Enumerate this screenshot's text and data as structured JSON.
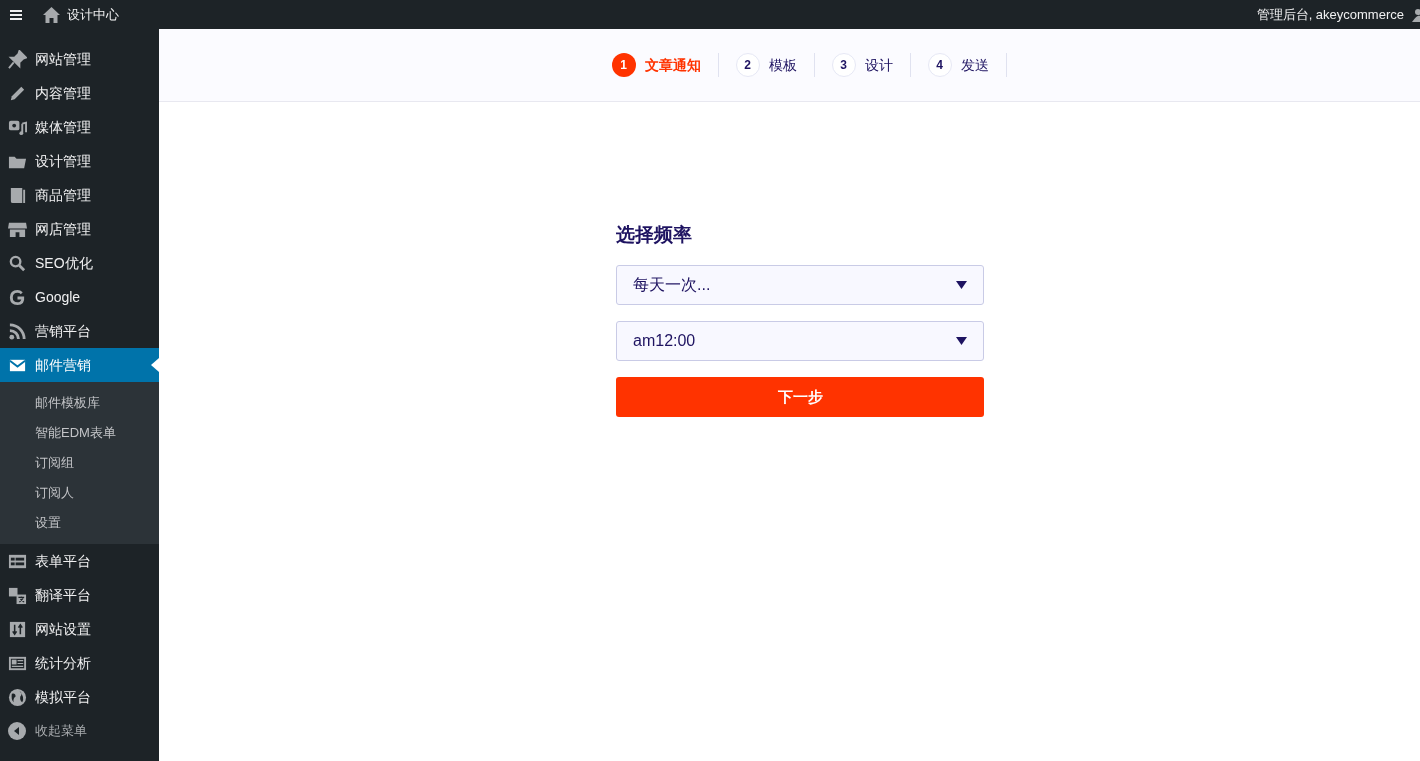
{
  "top_bar": {
    "site_title": "设计中心",
    "account": "管理后台, akeycommerce"
  },
  "sidebar": {
    "items": [
      {
        "label": "网站管理",
        "selected": false
      },
      {
        "label": "内容管理",
        "selected": false
      },
      {
        "label": "媒体管理",
        "selected": false
      },
      {
        "label": "设计管理",
        "selected": false
      },
      {
        "label": "商品管理",
        "selected": false
      },
      {
        "label": "网店管理",
        "selected": false
      },
      {
        "label": "SEO优化",
        "selected": false
      },
      {
        "label": "Google",
        "selected": false
      },
      {
        "label": "营销平台",
        "selected": false
      },
      {
        "label": "邮件营销",
        "selected": true,
        "children": [
          {
            "label": "邮件模板库"
          },
          {
            "label": "智能EDM表单"
          },
          {
            "label": "订阅组"
          },
          {
            "label": "订阅人"
          },
          {
            "label": "设置"
          }
        ]
      },
      {
        "label": "表单平台",
        "selected": false
      },
      {
        "label": "翻译平台",
        "selected": false
      },
      {
        "label": "网站设置",
        "selected": false
      },
      {
        "label": "统计分析",
        "selected": false
      },
      {
        "label": "模拟平台",
        "selected": false
      }
    ],
    "collapse": "收起菜单"
  },
  "steps": [
    {
      "number": "1",
      "label": "文章通知",
      "selected": true
    },
    {
      "number": "2",
      "label": "模板",
      "selected": false
    },
    {
      "number": "3",
      "label": "设计",
      "selected": false
    },
    {
      "number": "4",
      "label": "发送",
      "selected": false
    }
  ],
  "form": {
    "heading": "选择频率",
    "selects": [
      {
        "value": "每天一次..."
      },
      {
        "value": "am12:00"
      }
    ],
    "button": "下一步"
  }
}
